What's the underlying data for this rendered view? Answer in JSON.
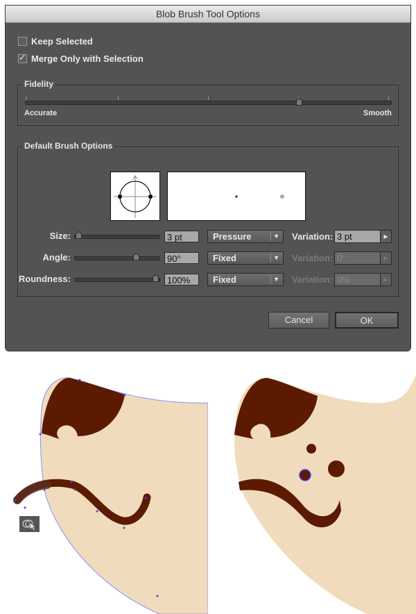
{
  "dialog": {
    "title": "Blob Brush Tool Options",
    "keep_selected": {
      "label": "Keep Selected",
      "checked": false
    },
    "merge_only": {
      "label": "Merge Only with Selection",
      "checked": true
    },
    "fidelity": {
      "label": "Fidelity",
      "min_label": "Accurate",
      "max_label": "Smooth",
      "value_fraction": 0.75
    },
    "brush_options": {
      "label": "Default Brush Options",
      "rows": [
        {
          "name": "size",
          "label": "Size:",
          "value": "3 pt",
          "slider_fraction": 0.02,
          "mode": "Pressure",
          "variation_label": "Variation:",
          "variation": "3 pt",
          "variation_enabled": true
        },
        {
          "name": "angle",
          "label": "Angle:",
          "value": "90°",
          "slider_fraction": 0.75,
          "mode": "Fixed",
          "variation_label": "Variation:",
          "variation": "0°",
          "variation_enabled": false
        },
        {
          "name": "roundness",
          "label": "Roundness:",
          "value": "100%",
          "slider_fraction": 1.0,
          "mode": "Fixed",
          "variation_label": "Variation:",
          "variation": "0%",
          "variation_enabled": false
        }
      ]
    },
    "cancel_label": "Cancel",
    "ok_label": "OK"
  },
  "artwork": {
    "skin_color": "#f0dcbc",
    "brown_color": "#5c1a00",
    "selection_color": "#6b6bff",
    "tool_cursor_icon": "blob-brush-cursor-icon"
  }
}
